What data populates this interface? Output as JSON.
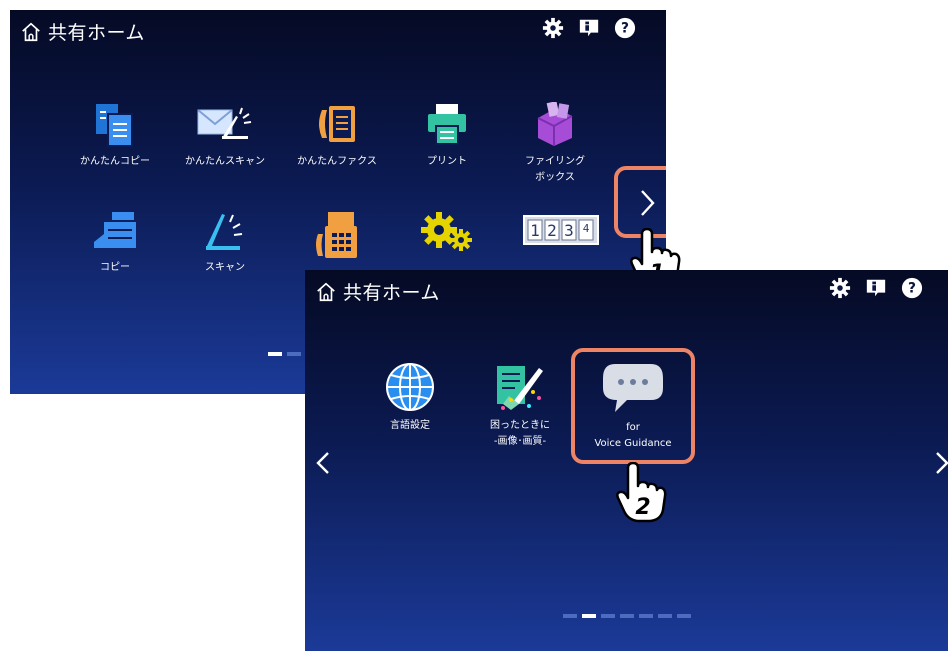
{
  "screen1": {
    "title": "共有ホーム",
    "apps": [
      {
        "label": "かんたんコピー",
        "icon": "easy-copy-icon"
      },
      {
        "label": "かんたんスキャン",
        "icon": "easy-scan-icon"
      },
      {
        "label": "かんたんファクス",
        "icon": "easy-fax-icon"
      },
      {
        "label": "プリント",
        "icon": "print-icon"
      },
      {
        "label": "ファイリング\nボックス",
        "icon": "filing-box-icon"
      },
      {
        "label": "コピー",
        "icon": "copy-icon"
      },
      {
        "label": "スキャン",
        "icon": "scan-icon"
      },
      {
        "label": "",
        "icon": "fax-icon"
      },
      {
        "label": "",
        "icon": "settings-gears-icon"
      },
      {
        "label": "",
        "icon": "counter-icon"
      }
    ],
    "page_indicator": {
      "count": 2,
      "current": 1
    }
  },
  "screen2": {
    "title": "共有ホーム",
    "apps": [
      {
        "label": "言語設定",
        "icon": "globe-icon"
      },
      {
        "label": "困ったときに\n-画像･画質-",
        "icon": "troubleshoot-icon"
      },
      {
        "label": "for\nVoice Guidance",
        "icon": "speech-bubble-icon"
      }
    ],
    "page_indicator": {
      "count": 7,
      "current": 2
    }
  },
  "steps": {
    "first": "1",
    "second": "2"
  },
  "colors": {
    "highlight": "#ee8466",
    "screen_top": "#050a24",
    "screen_bottom": "#1b3a98",
    "dot_active": "#ffffff",
    "dot_inactive": "#4d6cc0"
  }
}
